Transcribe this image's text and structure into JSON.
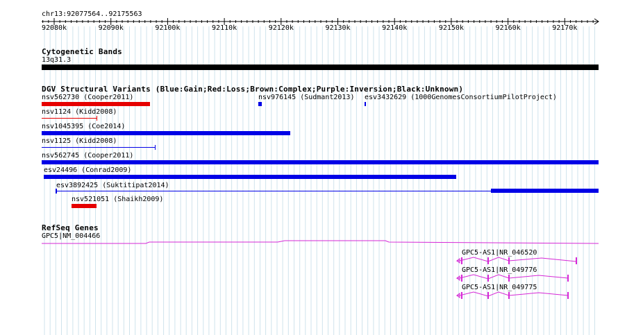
{
  "ruler": {
    "coordinates": "chr13:92077564..92175563",
    "ticks": [
      "92080k",
      "92090k",
      "92100k",
      "92110k",
      "92120k",
      "92130k",
      "92140k",
      "92150k",
      "92160k",
      "92170k"
    ]
  },
  "cytoband": {
    "title": "Cytogenetic Bands",
    "band_label": "13q31.3"
  },
  "dgv": {
    "title": "DGV Structural Variants (Blue:Gain;Red:Loss;Brown:Complex;Purple:Inversion;Black:Unknown)",
    "colors": {
      "gain": "#0000e6",
      "loss": "#e60000"
    },
    "variants": [
      {
        "label": "nsv562730 (Cooper2011)"
      },
      {
        "label": "nsv976145 (Sudmant2013)"
      },
      {
        "label": "esv3432629 (1000GenomesConsortiumPilotProject)"
      },
      {
        "label": "nsv1124 (Kidd2008)"
      },
      {
        "label": "nsv1045395 (Coe2014)"
      },
      {
        "label": "nsv1125 (Kidd2008)"
      },
      {
        "label": "nsv562745 (Cooper2011)"
      },
      {
        "label": "esv24496 (Conrad2009)"
      },
      {
        "label": "esv3892425 (Suktitipat2014)"
      },
      {
        "label": "nsv521051 (Shaikh2009)"
      }
    ]
  },
  "refseq": {
    "title": "RefSeq Genes",
    "color": "#d627d6",
    "genes": [
      {
        "label": "GPC5|NM_004466"
      },
      {
        "label": "GPC5-AS1|NR_046520"
      },
      {
        "label": "GPC5-AS1|NR_049776"
      },
      {
        "label": "GPC5-AS1|NR_049775"
      }
    ]
  }
}
